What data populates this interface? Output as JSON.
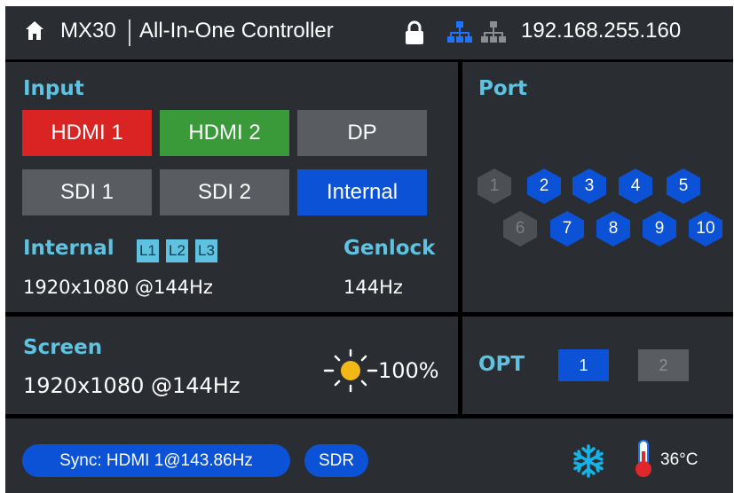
{
  "header": {
    "model": "MX30",
    "controller": "All-In-One Controller",
    "ip": "192.168.255.160"
  },
  "input": {
    "title": "Input",
    "buttons": [
      {
        "label": "HDMI 1",
        "state": "red"
      },
      {
        "label": "HDMI 2",
        "state": "green"
      },
      {
        "label": "DP",
        "state": "gray"
      },
      {
        "label": "SDI 1",
        "state": "gray"
      },
      {
        "label": "SDI 2",
        "state": "gray"
      },
      {
        "label": "Internal",
        "state": "blue"
      }
    ],
    "internal_label": "Internal",
    "layers": [
      "L1",
      "L2",
      "L3"
    ],
    "internal_value": "1920x1080 @144Hz",
    "genlock_label": "Genlock",
    "genlock_value": "144Hz"
  },
  "port": {
    "title": "Port",
    "ports": [
      {
        "label": "1",
        "active": false
      },
      {
        "label": "2",
        "active": true
      },
      {
        "label": "3",
        "active": true
      },
      {
        "label": "4",
        "active": true
      },
      {
        "label": "5",
        "active": true
      },
      {
        "label": "6",
        "active": false
      },
      {
        "label": "7",
        "active": true
      },
      {
        "label": "8",
        "active": true
      },
      {
        "label": "9",
        "active": true
      },
      {
        "label": "10",
        "active": true
      }
    ]
  },
  "screen": {
    "title": "Screen",
    "value": "1920x1080 @144Hz",
    "brightness": "100%"
  },
  "opt": {
    "title": "OPT",
    "items": [
      {
        "label": "1",
        "active": true
      },
      {
        "label": "2",
        "active": false
      }
    ]
  },
  "status": {
    "sync": "Sync: HDMI 1@143.86Hz",
    "dynamic_range": "SDR",
    "temperature": "36°C"
  },
  "colors": {
    "accent": "#5ec2e0",
    "active_blue": "#0c52d6",
    "red": "#da2424",
    "green": "#3a9a3a",
    "panel": "#2a2d31",
    "inactive": "#595d62"
  },
  "icons": [
    "home-icon",
    "lock-icon",
    "network-active-icon",
    "network-inactive-icon",
    "sun-icon",
    "snowflake-icon",
    "thermometer-icon"
  ]
}
